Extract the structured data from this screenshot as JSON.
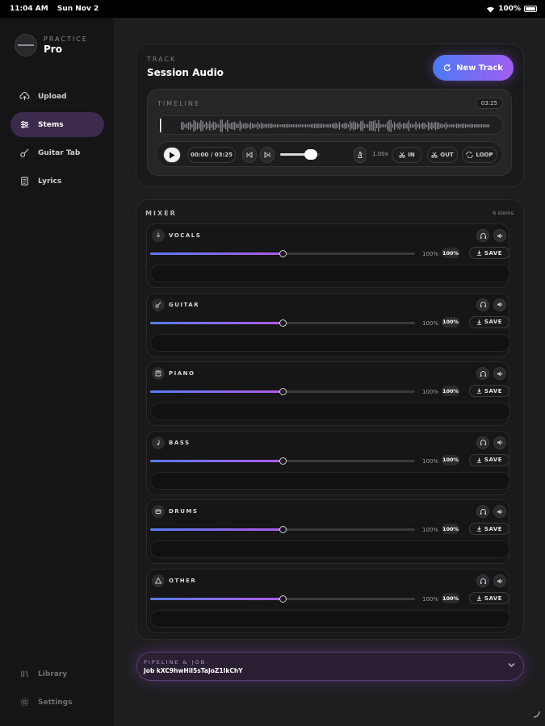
{
  "status_bar": {
    "time": "11:04 AM",
    "date": "Sun Nov 2",
    "battery": "100%"
  },
  "brand": {
    "eyebrow": "PRACTICE",
    "name": "Pro"
  },
  "nav": [
    {
      "label": "Upload",
      "icon": "cloud-upload-icon",
      "active": false
    },
    {
      "label": "Stems",
      "icon": "sliders-icon",
      "active": true
    },
    {
      "label": "Guitar Tab",
      "icon": "guitar-icon",
      "active": false
    },
    {
      "label": "Lyrics",
      "icon": "document-icon",
      "active": false
    }
  ],
  "nav_bottom": [
    {
      "label": "Library",
      "icon": "library-icon"
    },
    {
      "label": "Settings",
      "icon": "gear-icon"
    }
  ],
  "track": {
    "eyebrow": "TRACK",
    "title": "Session Audio",
    "new_button": "New Track",
    "timeline_label": "TIMELINE",
    "duration": "03:25",
    "position": "00:00 / 03:25",
    "volume_level": 0.75,
    "speed": "1.00x",
    "in_label": "IN",
    "out_label": "OUT",
    "loop_label": "LOOP"
  },
  "mixer": {
    "title": "MIXER",
    "count": "6 stems",
    "stems": [
      {
        "name": "VOCALS",
        "icon": "mic-icon",
        "level_pct": 100,
        "label": "100%",
        "badge": "100%",
        "save": "SAVE"
      },
      {
        "name": "GUITAR",
        "icon": "guitar-icon",
        "level_pct": 100,
        "label": "100%",
        "badge": "100%",
        "save": "SAVE"
      },
      {
        "name": "PIANO",
        "icon": "piano-icon",
        "level_pct": 100,
        "label": "100%",
        "badge": "100%",
        "save": "SAVE"
      },
      {
        "name": "BASS",
        "icon": "music-note-icon",
        "level_pct": 100,
        "label": "100%",
        "badge": "100%",
        "save": "SAVE"
      },
      {
        "name": "DRUMS",
        "icon": "drum-icon",
        "level_pct": 100,
        "label": "100%",
        "badge": "100%",
        "save": "SAVE"
      },
      {
        "name": "OTHER",
        "icon": "shapes-icon",
        "level_pct": 100,
        "label": "100%",
        "badge": "100%",
        "save": "SAVE"
      }
    ]
  },
  "pipeline": {
    "title": "PIPELINE & JOB",
    "job": "Job kXC9hwHiI5sTaJoZ1IkChY"
  },
  "colors": {
    "accent_start": "#4b7bf5",
    "accent_end": "#a25ef0",
    "background": "#1e1e1f",
    "sidebar": "#151516"
  }
}
